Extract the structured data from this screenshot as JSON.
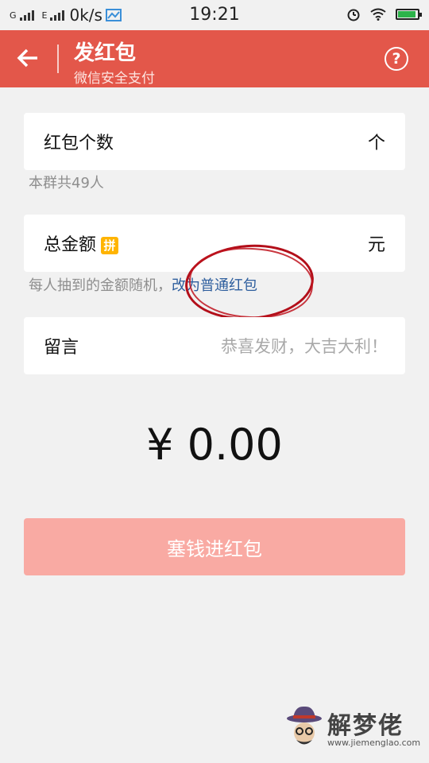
{
  "status_bar": {
    "sim1": "G",
    "sim2": "E",
    "net_speed": "0k/s",
    "time": "19:21",
    "battery_level": 0.9
  },
  "header": {
    "title": "发红包",
    "subtitle": "微信安全支付",
    "help_symbol": "?"
  },
  "count_card": {
    "label": "红包个数",
    "unit": "个",
    "hint": "本群共49人"
  },
  "amount_card": {
    "label": "总金额",
    "badge": "拼",
    "unit": "元",
    "hint": "每人抽到的金额随机，",
    "hint_link": "改为普通红包"
  },
  "message_card": {
    "label": "留言",
    "placeholder": "恭喜发财，大吉大利！"
  },
  "total_display": "¥ 0.00",
  "submit_label": "塞钱进红包",
  "colors": {
    "header_bg": "#e3574a",
    "button_bg": "#f9aaa3",
    "link": "#2f5f9e",
    "annotation": "#b30f1a"
  },
  "watermark": {
    "name": "解梦佬",
    "url": "www.jiemenglao.com"
  }
}
